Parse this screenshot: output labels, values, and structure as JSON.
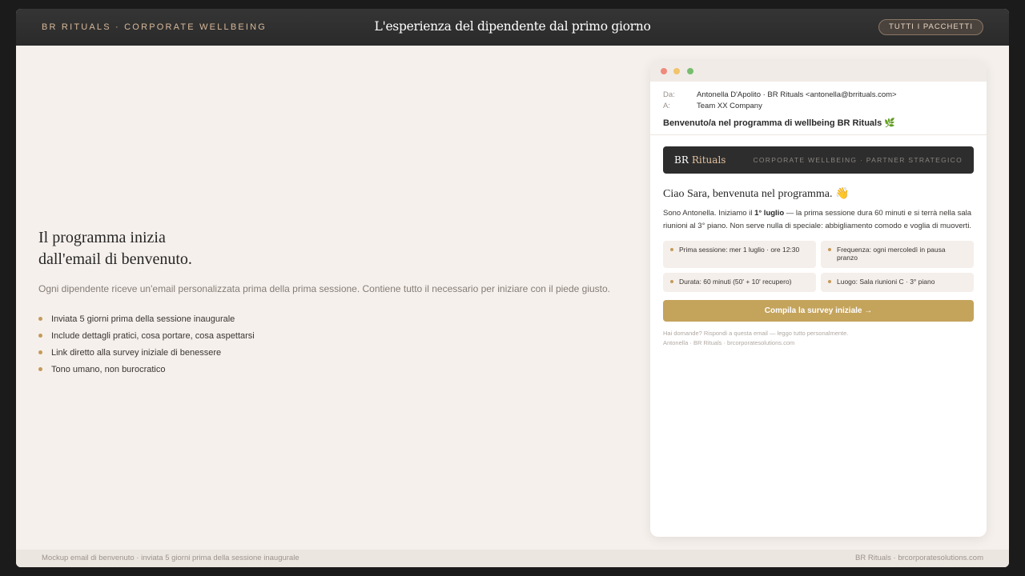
{
  "topbar": {
    "brand": "BR RITUALS · CORPORATE WELLBEING",
    "title": "L'esperienza del dipendente dal primo giorno",
    "button": "TUTTI I PACCHETTI"
  },
  "left": {
    "headline_line1": "Il programma inizia",
    "headline_line2": "dall'email di benvenuto.",
    "subtext": "Ogni dipendente riceve un'email personalizzata prima della prima sessione. Contiene tutto il necessario per iniziare con il piede giusto.",
    "bullets": [
      "Inviata 5 giorni prima della sessione inaugurale",
      "Include dettagli pratici, cosa portare, cosa aspettarsi",
      "Link diretto alla survey iniziale di benessere",
      "Tono umano, non burocratico"
    ]
  },
  "email": {
    "from_label": "Da:",
    "from_value": "Antonella D'Apolito · BR Rituals <antonella@brrituals.com>",
    "to_label": "A:",
    "to_value": "Team XX Company",
    "subject": "Benvenuto/a nel programma di wellbeing BR Rituals 🌿",
    "banner_logo_br": "BR",
    "banner_logo_rituals": "Rituals",
    "banner_tag": "CORPORATE WELLBEING · PARTNER STRATEGICO",
    "greeting": "Ciao Sara, benvenuta nel programma. 👋",
    "para_before": "Sono Antonella. Iniziamo il ",
    "para_bold": "1° luglio",
    "para_after": " — la prima sessione dura 60 minuti e si terrà nella sala riunioni al 3° piano. Non serve nulla di speciale: abbigliamento comodo e voglia di muoverti.",
    "cards": [
      "Prima sessione: mer 1 luglio · ore 12:30",
      "Frequenza: ogni mercoledì in pausa pranzo",
      "Durata: 60 minuti (50' + 10' recupero)",
      "Luogo: Sala riunioni C · 3° piano"
    ],
    "cta": "Compila la survey iniziale →",
    "footer_line1": "Hai domande? Rispondi a questa email — leggo tutto personalmente.",
    "footer_line2": "Antonella · BR Rituals · brcorporatesolutions.com"
  },
  "bottombar": {
    "left": "Mockup email di benvenuto · inviata 5 giorni prima della sessione inaugurale",
    "right": "BR Rituals · brcorporatesolutions.com"
  },
  "colors": {
    "accent_gold": "#c4a35b",
    "dark_bar": "#2d2d2d",
    "page_bg": "#f5f0ec"
  }
}
